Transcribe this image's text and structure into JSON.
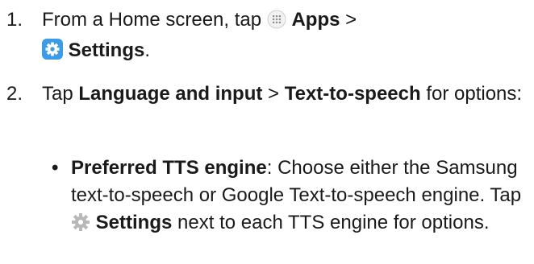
{
  "steps": [
    {
      "number": "1.",
      "from": "From a Home screen, tap",
      "apps_label": "Apps",
      "sep": ">",
      "settings_label": "Settings",
      "end": "."
    },
    {
      "number": "2.",
      "tap": "Tap",
      "lang_label": "Language and input",
      "sep": ">",
      "tts_label": "Text-to-speech",
      "tail": "for options:"
    }
  ],
  "bullet": {
    "marker": "•",
    "title": "Preferred TTS engine",
    "desc1": ": Choose either the Samsung text-to-speech or Google Text-to-speech engine. Tap",
    "settings_label": "Settings",
    "desc2": "next to each TTS engine for options."
  },
  "icons": {
    "apps": "apps-grid-icon",
    "settings": "settings-gear-icon",
    "gear": "gear-icon"
  },
  "colors": {
    "settings_icon_bg": "#3b9be6",
    "gear_icon": "#b8b8b8",
    "text": "#1a1a1a"
  }
}
